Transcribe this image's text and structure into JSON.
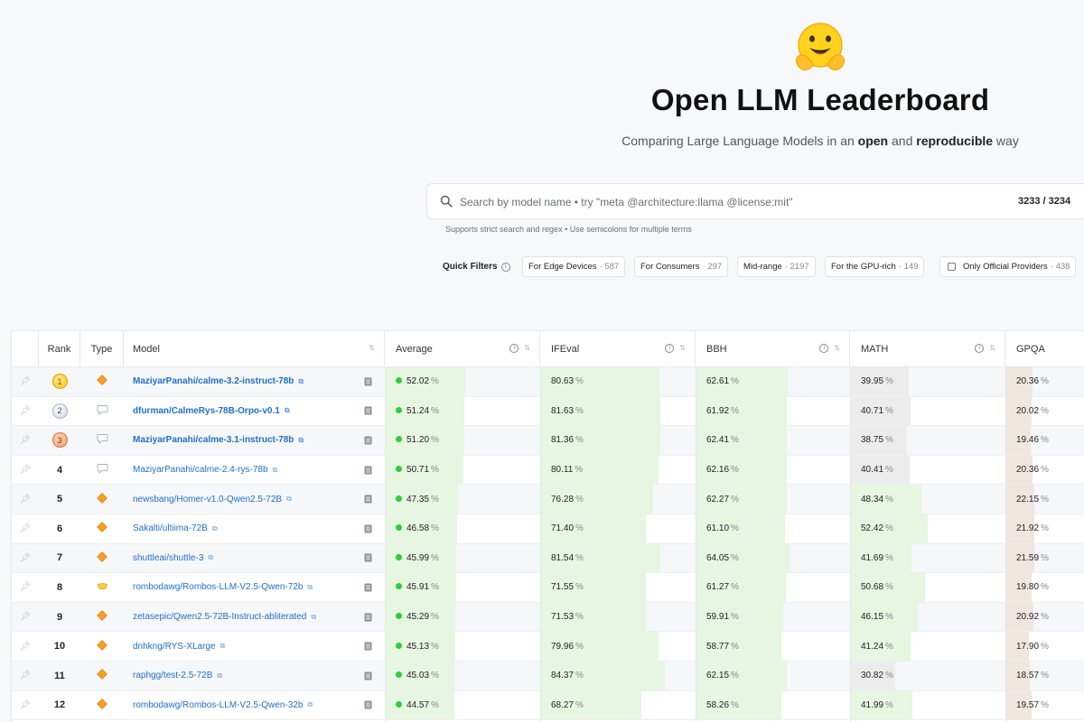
{
  "header": {
    "title": "Open LLM Leaderboard",
    "subtitle_pre": "Comparing Large Language Models in an ",
    "subtitle_b1": "open",
    "subtitle_mid": " and ",
    "subtitle_b2": "reproducible",
    "subtitle_post": " way"
  },
  "search": {
    "placeholder": "Search by model name • try \"meta @architecture:llama @license:mit\"",
    "count": "3233 / 3234",
    "help": "Supports strict search and regex • Use semicolons for multiple terms"
  },
  "quick_filters": {
    "label": "Quick Filters",
    "chips": [
      {
        "label": "For Edge Devices",
        "count": "· 587"
      },
      {
        "label": "For Consumers",
        "count": "· 297"
      },
      {
        "label": "Mid-range",
        "count": "· 2197"
      },
      {
        "label": "For the GPU-rich",
        "count": "· 149"
      },
      {
        "label": "Only Official Providers",
        "count": "· 438"
      }
    ]
  },
  "table": {
    "columns": {
      "rank": "Rank",
      "type": "Type",
      "model": "Model",
      "average": "Average",
      "ifeval": "IFEval",
      "bbh": "BBH",
      "math": "MATH",
      "gpqa": "GPQA"
    },
    "pct_suffix": "%",
    "rows": [
      {
        "rank": "1",
        "medal": "gold",
        "type": "diamond-icon",
        "model": "MaziyarPanahi/calme-3.2-instruct-78b",
        "bold": true,
        "average": "52.02",
        "ifeval": "80.63",
        "bbh": "62.61",
        "math": "39.95",
        "gpqa": "20.36"
      },
      {
        "rank": "2",
        "medal": "silver",
        "type": "chat-icon",
        "model": "dfurman/CalmeRys-78B-Orpo-v0.1",
        "bold": true,
        "average": "51.24",
        "ifeval": "81.63",
        "bbh": "61.92",
        "math": "40.71",
        "gpqa": "20.02"
      },
      {
        "rank": "3",
        "medal": "bronze",
        "type": "chat-icon",
        "model": "MaziyarPanahi/calme-3.1-instruct-78b",
        "bold": true,
        "average": "51.20",
        "ifeval": "81.36",
        "bbh": "62.41",
        "math": "38.75",
        "gpqa": "19.46"
      },
      {
        "rank": "4",
        "medal": "",
        "type": "chat-icon",
        "model": "MaziyarPanahi/calme-2.4-rys-78b",
        "bold": false,
        "average": "50.71",
        "ifeval": "80.11",
        "bbh": "62.16",
        "math": "40.41",
        "gpqa": "20.36"
      },
      {
        "rank": "5",
        "medal": "",
        "type": "diamond-icon",
        "model": "newsbang/Homer-v1.0-Qwen2.5-72B",
        "bold": false,
        "average": "47.35",
        "ifeval": "76.28",
        "bbh": "62.27",
        "math": "48.34",
        "gpqa": "22.15"
      },
      {
        "rank": "6",
        "medal": "",
        "type": "diamond-icon",
        "model": "Sakalti/ultiima-72B",
        "bold": false,
        "average": "46.58",
        "ifeval": "71.40",
        "bbh": "61.10",
        "math": "52.42",
        "gpqa": "21.92"
      },
      {
        "rank": "7",
        "medal": "",
        "type": "diamond-icon",
        "model": "shuttleai/shuttle-3",
        "bold": false,
        "average": "45.99",
        "ifeval": "81.54",
        "bbh": "64.05",
        "math": "41.69",
        "gpqa": "21.59"
      },
      {
        "rank": "8",
        "medal": "",
        "type": "merge-icon",
        "model": "rombodawg/Rombos-LLM-V2.5-Qwen-72b",
        "bold": false,
        "average": "45.91",
        "ifeval": "71.55",
        "bbh": "61.27",
        "math": "50.68",
        "gpqa": "19.80"
      },
      {
        "rank": "9",
        "medal": "",
        "type": "diamond-icon",
        "model": "zetasepic/Qwen2.5-72B-Instruct-abliterated",
        "bold": false,
        "average": "45.29",
        "ifeval": "71.53",
        "bbh": "59.91",
        "math": "46.15",
        "gpqa": "20.92"
      },
      {
        "rank": "10",
        "medal": "",
        "type": "diamond-icon",
        "model": "dnhkng/RYS-XLarge",
        "bold": false,
        "average": "45.13",
        "ifeval": "79.96",
        "bbh": "58.77",
        "math": "41.24",
        "gpqa": "17.90"
      },
      {
        "rank": "11",
        "medal": "",
        "type": "diamond-icon",
        "model": "raphgg/test-2.5-72B",
        "bold": false,
        "average": "45.03",
        "ifeval": "84.37",
        "bbh": "62.15",
        "math": "30.82",
        "gpqa": "18.57"
      },
      {
        "rank": "12",
        "medal": "",
        "type": "diamond-icon",
        "model": "rombodawg/Rombos-LLM-V2.5-Qwen-32b",
        "bold": false,
        "average": "44.57",
        "ifeval": "68.27",
        "bbh": "58.26",
        "math": "41.99",
        "gpqa": "19.57"
      }
    ]
  },
  "colors": {
    "bar_green": "#e6f6e1",
    "bar_green_alt": "#dff2da",
    "math_low": "#ececec",
    "gpqa_bar": "#efe6e0",
    "link": "#1f6fd1",
    "dot": "#2ecc40"
  }
}
